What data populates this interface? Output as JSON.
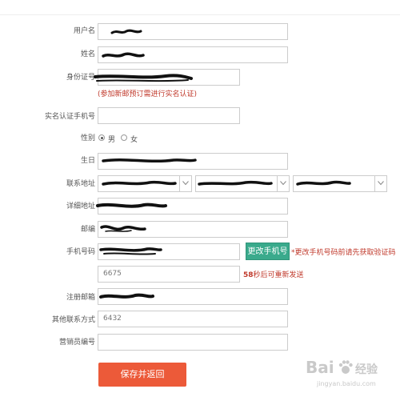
{
  "form": {
    "username_label": "用户名",
    "name_label": "姓名",
    "idcard_label": "身份证号",
    "idcard_hint": "(参加新邮预订需进行实名认证)",
    "realname_phone_label": "实名认证手机号",
    "gender_label": "性别",
    "gender_male": "男",
    "gender_female": "女",
    "gender_selected": "男",
    "birthday_label": "生日",
    "address_label": "联系地址",
    "detail_address_label": "详细地址",
    "postcode_label": "邮编",
    "mobile_label": "手机号码",
    "change_phone_button": "更改手机号",
    "change_phone_note": "*更改手机号码前请先获取验证码",
    "verify_code_value": "6675",
    "countdown_seconds": "58",
    "countdown_suffix": "秒后可重新发送",
    "email_label": "注册邮箱",
    "other_contact_label": "其他联系方式",
    "other_contact_value": "6432",
    "salesperson_label": "营销员编号",
    "save_button": "保存并返回"
  },
  "watermark": {
    "brand": "Bai",
    "brand_tail": "经验",
    "url": "jingyan.baidu.com"
  },
  "colors": {
    "accent_green": "#3aaa8c",
    "accent_red": "#ec5a39",
    "hint_red": "#c0392b",
    "border": "#cccccc"
  }
}
